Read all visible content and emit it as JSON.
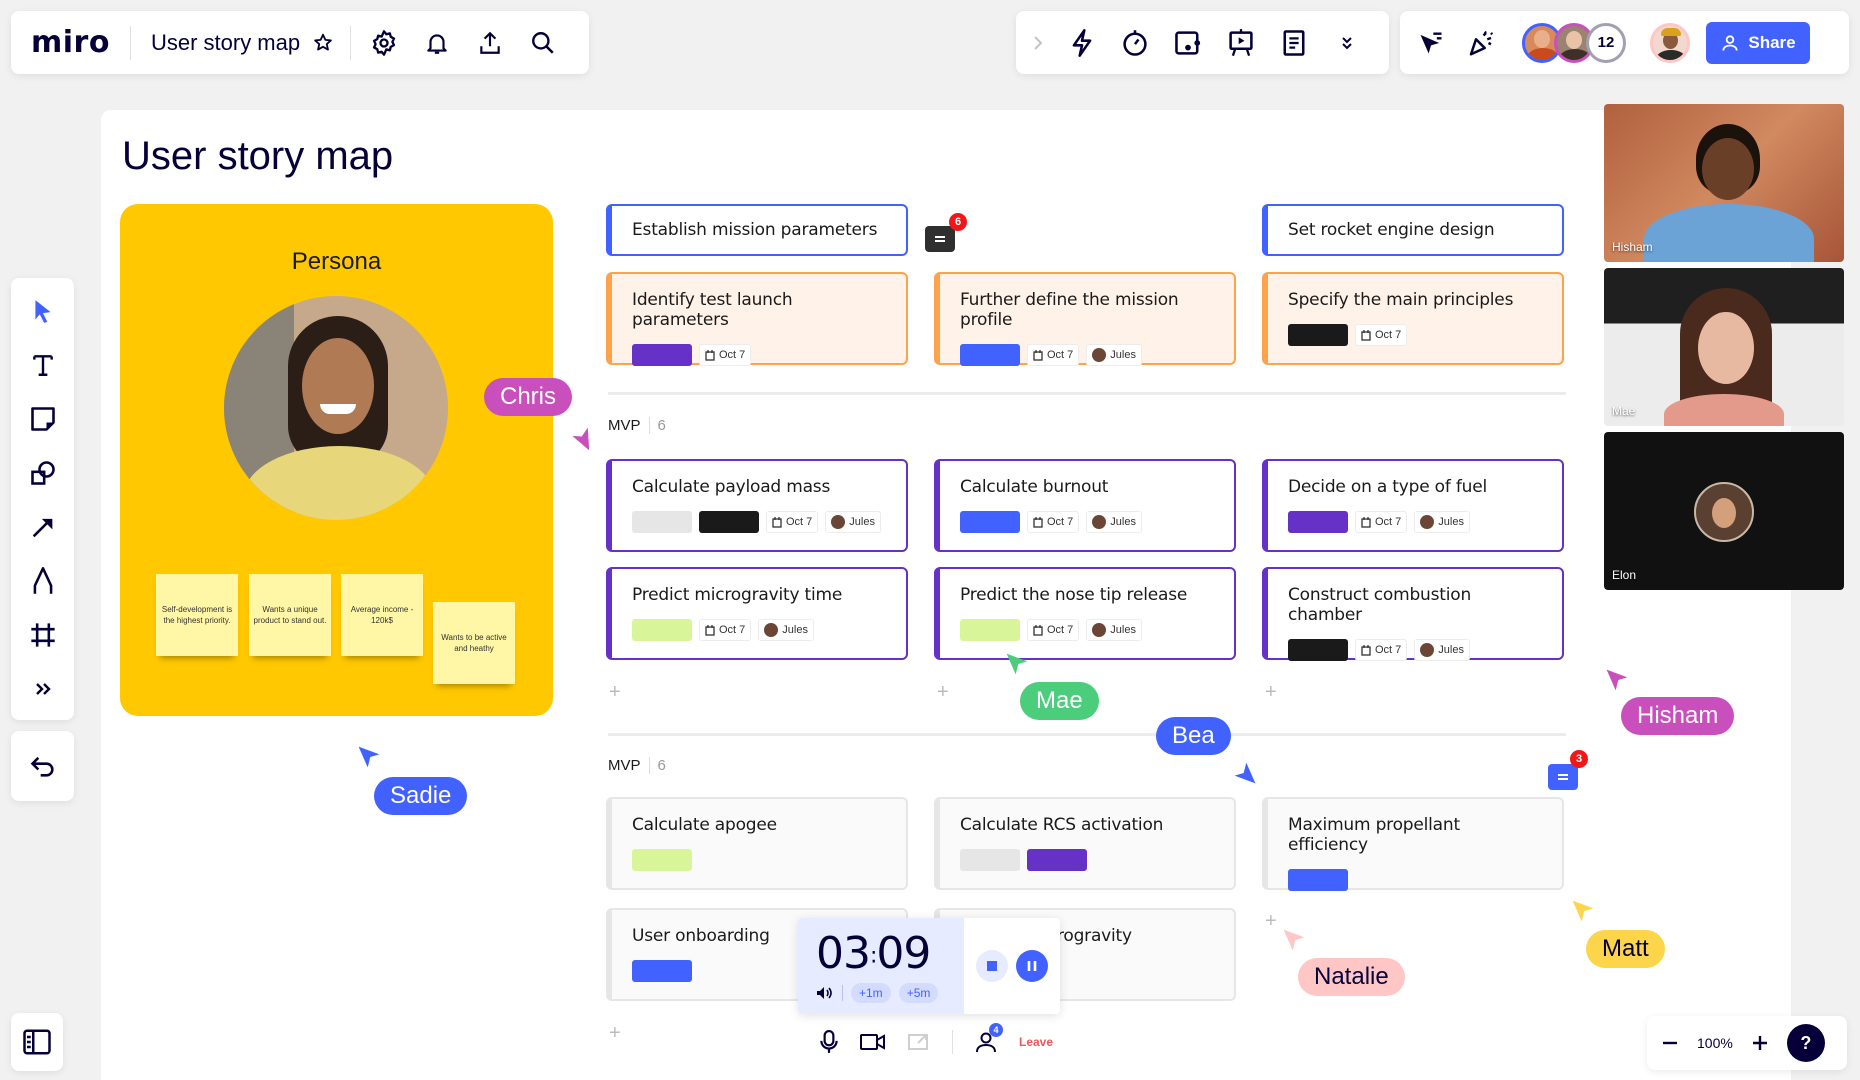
{
  "app": {
    "logo": "miro",
    "board_title": "User story map"
  },
  "top_toolbar": {
    "left_icons": [
      "star-icon",
      "gear-icon",
      "bell-icon",
      "upload-icon",
      "search-icon"
    ],
    "mid_icons": [
      "chevron-right-icon",
      "lightning-icon",
      "timer-icon",
      "card-icon",
      "presentation-icon",
      "notes-icon",
      "chevrons-down-icon"
    ],
    "right_icons": [
      "cursor-filter-icon",
      "celebrate-icon"
    ],
    "collaborator_overflow": "12",
    "share_label": "Share"
  },
  "page_title": "User story map",
  "tools": [
    "select",
    "text",
    "sticky-note",
    "shapes",
    "arrow",
    "pen",
    "frame",
    "more"
  ],
  "persona": {
    "label": "Persona",
    "stickies": [
      "Self-development is the highest priority.",
      "Wants a unique product to stand out.",
      "Average income - 120k$",
      "Wants to be active and heathy"
    ]
  },
  "colors": {
    "accent": "#4262ff",
    "purple": "#6631c7",
    "orange": "#ffa24c",
    "lime": "#d9f59a",
    "black": "#1a1a1a",
    "grey": "#e6e6e6",
    "yellow": "#ffc800"
  },
  "epics": [
    "Establish mission parameters",
    "Set rocket engine design"
  ],
  "activities": [
    {
      "title": "Identify test launch parameters",
      "chips": [
        "purple"
      ],
      "date": "Oct 7",
      "assignee": ""
    },
    {
      "title": "Further define the mission profile",
      "chips": [
        "accent"
      ],
      "date": "Oct 7",
      "assignee": "Jules"
    },
    {
      "title": "Specify the main principles",
      "chips": [
        "black"
      ],
      "date": "Oct 7",
      "assignee": ""
    }
  ],
  "sections": [
    {
      "label": "MVP",
      "count": "6",
      "cards": [
        {
          "title": "Calculate payload mass",
          "chips": [
            "grey",
            "black"
          ],
          "date": "Oct 7",
          "assignee": "Jules"
        },
        {
          "title": "Calculate burnout",
          "chips": [
            "accent"
          ],
          "date": "Oct 7",
          "assignee": "Jules"
        },
        {
          "title": "Decide on a type of fuel",
          "chips": [
            "purple"
          ],
          "date": "Oct 7",
          "assignee": "Jules"
        },
        {
          "title": "Predict microgravity time",
          "chips": [
            "lime"
          ],
          "date": "Oct 7",
          "assignee": "Jules"
        },
        {
          "title": "Predict the nose tip release",
          "chips": [
            "lime"
          ],
          "date": "Oct 7",
          "assignee": "Jules"
        },
        {
          "title": "Construct combustion chamber",
          "chips": [
            "black"
          ],
          "date": "Oct 7",
          "assignee": "Jules"
        }
      ]
    },
    {
      "label": "MVP",
      "count": "6",
      "cards": [
        {
          "title": "Calculate apogee",
          "chips": [
            "lime"
          ]
        },
        {
          "title": "Calculate RCS activation",
          "chips": [
            "grey",
            "purple"
          ]
        },
        {
          "title": "Maximum propellant efficiency",
          "chips": [
            "accent"
          ]
        },
        {
          "title": "User onboarding",
          "chips": [
            "accent"
          ]
        },
        {
          "title": "Start of microgravity",
          "chips": [
            "accent"
          ]
        }
      ]
    }
  ],
  "comments": [
    {
      "count": "6"
    },
    {
      "count": "3"
    }
  ],
  "cursors": [
    {
      "name": "Chris",
      "color": "#c94fbd"
    },
    {
      "name": "Sadie",
      "color": "#4262ff"
    },
    {
      "name": "Mae",
      "color": "#4ccd7b"
    },
    {
      "name": "Bea",
      "color": "#4262ff"
    },
    {
      "name": "Hisham",
      "color": "#c94fbd"
    },
    {
      "name": "Natalie",
      "color": "#ffc6c6"
    },
    {
      "name": "Matt",
      "color": "#fcd54a"
    }
  ],
  "video_tiles": [
    {
      "name": "Hisham"
    },
    {
      "name": "Mae"
    },
    {
      "name": "Elon"
    }
  ],
  "timer": {
    "minutes": "03",
    "seconds": "09",
    "add1": "+1m",
    "add5": "+5m"
  },
  "call": {
    "participants": "4",
    "leave_label": "Leave"
  },
  "zoom": {
    "level": "100%",
    "help": "?"
  }
}
